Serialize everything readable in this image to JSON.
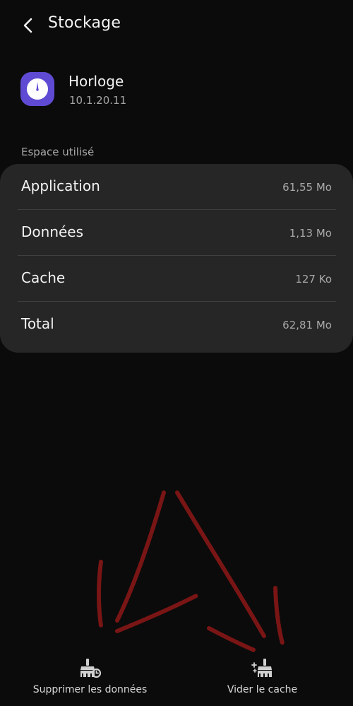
{
  "topbar": {
    "back_icon": "chevron-left-icon",
    "title": "Stockage"
  },
  "app": {
    "icon": "clock-icon",
    "name": "Horloge",
    "version": "10.1.20.11",
    "icon_color": "#5f4bd3"
  },
  "storage": {
    "section_label": "Espace utilisé",
    "rows": [
      {
        "label": "Application",
        "value": "61,55 Mo"
      },
      {
        "label": "Données",
        "value": "1,13 Mo"
      },
      {
        "label": "Cache",
        "value": "127 Ko"
      },
      {
        "label": "Total",
        "value": "62,81 Mo"
      }
    ]
  },
  "annotation": {
    "type": "hand-drawn-arrow",
    "color": "#7a1515"
  },
  "bottom_bar": {
    "clear_data": {
      "label": "Supprimer les données",
      "icon": "broom-clock-icon"
    },
    "clear_cache": {
      "label": "Vider le cache",
      "icon": "broom-sparkle-icon"
    }
  }
}
